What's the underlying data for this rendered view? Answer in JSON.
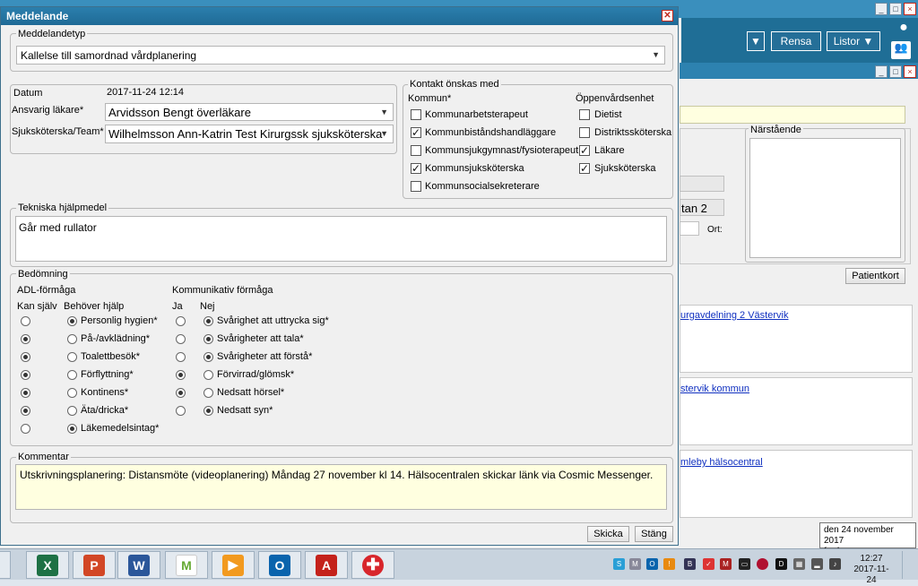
{
  "background": {
    "toolbar": {
      "rensa": "Rensa",
      "listor": "Listor"
    },
    "narstaende_label": "Närstående",
    "patientkort": "Patientkort",
    "address_fragment": "tan 2",
    "ort_label": "Ort:",
    "links": [
      "urgavdelning 2 Västervik",
      "stervik kommun",
      "mleby hälsocentral"
    ]
  },
  "dialog": {
    "title": "Meddelande",
    "meddelandetyp": {
      "legend": "Meddelandetyp",
      "value": "Kallelse till samordnad vårdplanering"
    },
    "datum": {
      "label": "Datum",
      "value": "2017-11-24 12:14"
    },
    "ansvarig": {
      "label": "Ansvarig läkare*",
      "value": "Arvidsson Bengt överläkare"
    },
    "sjukskoterska": {
      "label": "Sjuksköterska/Team*",
      "value": "Wilhelmsson Ann-Katrin Test Kirurgssk sjuksköterska"
    },
    "kontakt": {
      "legend": "Kontakt önskas med",
      "kommun_label": "Kommun*",
      "oppen_label": "Öppenvårdsenhet",
      "kommun": [
        {
          "label": "Kommunarbetsterapeut",
          "checked": false
        },
        {
          "label": "Kommunbiståndshandläggare",
          "checked": true
        },
        {
          "label": "Kommunsjukgymnast/fysioterapeut",
          "checked": false
        },
        {
          "label": "Kommunsjuksköterska",
          "checked": true
        },
        {
          "label": "Kommunsocialsekreterare",
          "checked": false
        }
      ],
      "oppen": [
        {
          "label": "Dietist",
          "checked": false
        },
        {
          "label": "Distriktssköterska",
          "checked": false
        },
        {
          "label": "Läkare",
          "checked": true
        },
        {
          "label": "Sjuksköterska",
          "checked": true
        }
      ]
    },
    "tekniska": {
      "legend": "Tekniska hjälpmedel",
      "value": "Går med rullator"
    },
    "bedomning": {
      "legend": "Bedömning",
      "adl_label": "ADL-förmåga",
      "kan_sjalv": "Kan själv",
      "behover_hjalp": "Behöver hjälp",
      "komm_label": "Kommunikativ förmåga",
      "ja": "Ja",
      "nej": "Nej",
      "adl": [
        {
          "label": "Personlig hygien*",
          "kan": false
        },
        {
          "label": "På-/avklädning*",
          "kan": true
        },
        {
          "label": "Toalettbesök*",
          "kan": true
        },
        {
          "label": "Förflyttning*",
          "kan": true
        },
        {
          "label": "Kontinens*",
          "kan": true
        },
        {
          "label": "Äta/dricka*",
          "kan": true
        },
        {
          "label": "Läkemedelsintag*",
          "kan": false
        }
      ],
      "komm": [
        {
          "label": "Svårighet att uttrycka sig*",
          "ja": false
        },
        {
          "label": "Svårigheter att tala*",
          "ja": false
        },
        {
          "label": "Svårigheter att förstå*",
          "ja": false
        },
        {
          "label": "Förvirrad/glömsk*",
          "ja": true
        },
        {
          "label": "Nedsatt hörsel*",
          "ja": true
        },
        {
          "label": "Nedsatt syn*",
          "ja": false
        }
      ]
    },
    "kommentar": {
      "legend": "Kommentar",
      "value": "Utskrivningsplanering: Distansmöte (videoplanering) Måndag 27 november kl 14. Hälsocentralen skickar länk via Cosmic Messenger."
    },
    "buttons": {
      "skicka": "Skicka",
      "stang": "Stäng"
    }
  },
  "tooltip": {
    "date": "den 24 november 2017",
    "day": "fredag"
  },
  "clock": {
    "time": "12:27",
    "date": "2017-11-24"
  },
  "colors": {
    "titlebar": "#2277a6",
    "comment_bg": "#ffffe0"
  }
}
